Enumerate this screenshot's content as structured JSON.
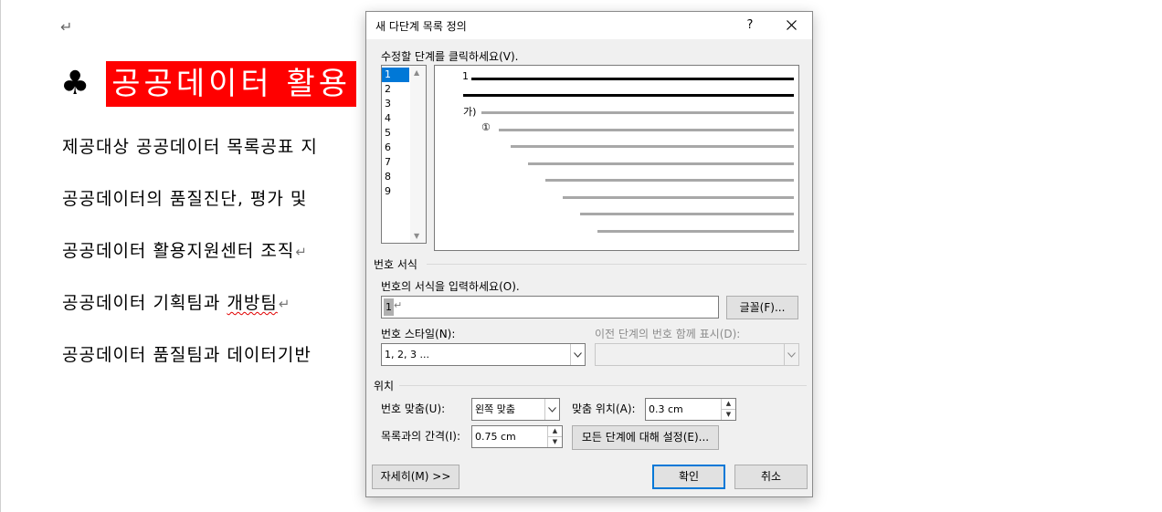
{
  "document": {
    "paragraph_mark": "↵",
    "heading_bullet": "♣",
    "heading_text": "공공데이터 활용",
    "lines": [
      {
        "text": "제공대상 공공데이터 목록공표 지",
        "mark": ""
      },
      {
        "text": "공공데이터의 품질진단, 평가 및 ",
        "mark": ""
      },
      {
        "text": "공공데이터 활용지원센터 조직",
        "mark": "↵"
      },
      {
        "text": "공공데이터 기획팀과 ",
        "underlined": "개방팀",
        "mark": "↵"
      },
      {
        "text": "공공데이터 품질팀과 데이터기반 ",
        "mark": ""
      }
    ]
  },
  "dialog": {
    "title": "새 다단계 목록 정의",
    "help": "?",
    "click_level_label": "수정할 단계를 클릭하세요(V).",
    "levels": [
      "1",
      "2",
      "3",
      "4",
      "5",
      "6",
      "7",
      "8",
      "9"
    ],
    "selected_level": "1",
    "preview": {
      "level1": "1",
      "level3": "가)",
      "level4": "①"
    },
    "number_format_section": "번호 서식",
    "enter_format_label": "번호의 서식을 입력하세요(O).",
    "format_value": "1",
    "format_mark": "↵",
    "font_button": "글꼴(F)...",
    "number_style_label": "번호 스타일(N):",
    "number_style_value": "1, 2, 3 ...",
    "include_level_label": "이전 단계의 번호 함께 표시(D):",
    "include_level_value": "",
    "position_section": "위치",
    "alignment_label": "번호 맞춤(U):",
    "alignment_value": "왼쪽 맞춤",
    "aligned_at_label": "맞춤 위치(A):",
    "aligned_at_value": "0.3 cm",
    "indent_label": "목록과의 간격(I):",
    "indent_value": "0.75 cm",
    "set_all_button": "모든 단계에 대해 설정(E)...",
    "more_button": "자세히(M) >>",
    "ok_button": "확인",
    "cancel_button": "취소"
  },
  "colors": {
    "accent": "#0078d7",
    "heading_highlight": "#ff0000"
  }
}
